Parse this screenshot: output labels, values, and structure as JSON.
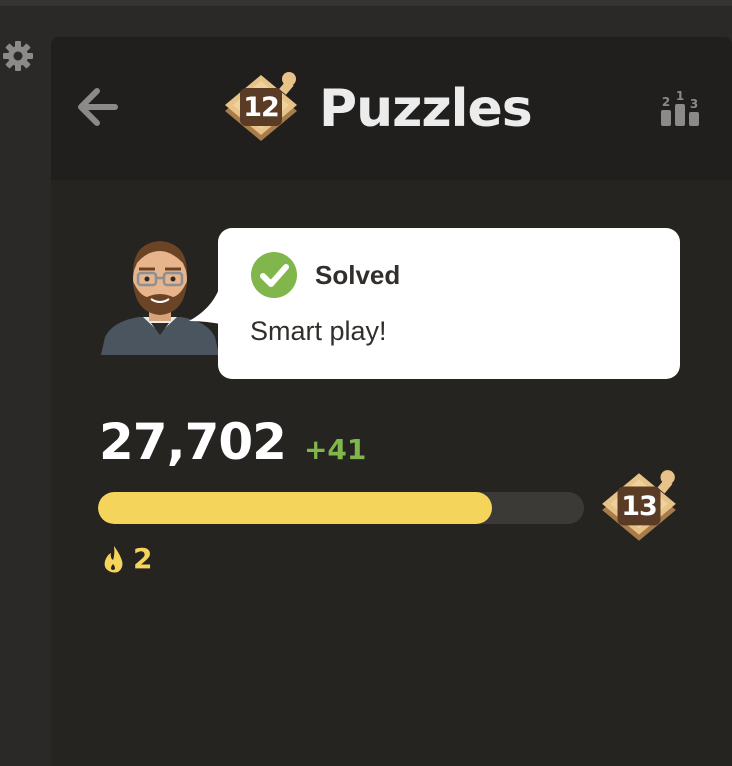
{
  "header": {
    "title": "Puzzles",
    "level_badge": "12"
  },
  "feedback": {
    "status": "Solved",
    "message": "Smart play!"
  },
  "rating": {
    "value": "27,702",
    "delta": "+41",
    "progress_fraction": 0.81,
    "next_level_badge": "13"
  },
  "streak": {
    "count": "2"
  },
  "icons": {
    "settings": "gear-icon",
    "back": "arrow-left-icon",
    "leaderboard": "podium-icon",
    "solved": "check-circle-icon",
    "streak": "flame-icon"
  },
  "colors": {
    "accent_green": "#81b64c",
    "progress_yellow": "#f5d45c",
    "panel_bg": "#262421",
    "header_bg": "#201f1d"
  },
  "leaderboard_icon_digits": [
    "2",
    "1",
    "3"
  ]
}
